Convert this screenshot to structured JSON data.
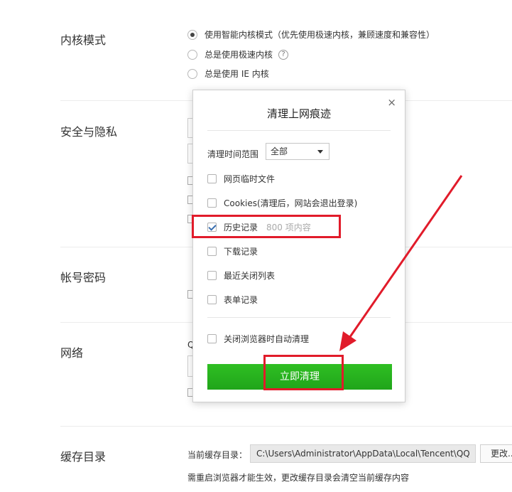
{
  "sections": {
    "kernel_mode": "内核模式",
    "security": "安全与隐私",
    "account": "帐号密码",
    "network": "网络",
    "cache": "缓存目录"
  },
  "kernel_options": [
    {
      "label": "使用智能内核模式（优先使用极速内核，兼顾速度和兼容性）",
      "selected": true
    },
    {
      "label": "总是使用极速内核",
      "selected": false
    },
    {
      "label": "总是使用 IE 内核",
      "selected": false
    }
  ],
  "help_glyph": "?",
  "network_stub_text": "Q",
  "cache": {
    "current_label": "当前缓存目录：",
    "path": "C:\\Users\\Administrator\\AppData\\Local\\Tencent\\QQ",
    "change_button": "更改...",
    "note": "需重启浏览器才能生效，更改缓存目录会清空当前缓存内容"
  },
  "dialog": {
    "title": "清理上网痕迹",
    "close": "×",
    "range_label": "清理时间范围",
    "range_value": "全部",
    "options": [
      {
        "label": "网页临时文件",
        "checked": false,
        "extra": ""
      },
      {
        "label": "Cookies(清理后，网站会退出登录)",
        "checked": false,
        "extra": ""
      },
      {
        "label": "历史记录",
        "checked": true,
        "extra": "800 项内容"
      },
      {
        "label": "下载记录",
        "checked": false,
        "extra": ""
      },
      {
        "label": "最近关闭列表",
        "checked": false,
        "extra": ""
      },
      {
        "label": "表单记录",
        "checked": false,
        "extra": ""
      }
    ],
    "auto_clean_label": "关闭浏览器时自动清理",
    "auto_clean_checked": false,
    "clean_button": "立即清理"
  },
  "colors": {
    "accent_green": "#22a81b",
    "annotation_red": "#e11b2a"
  }
}
